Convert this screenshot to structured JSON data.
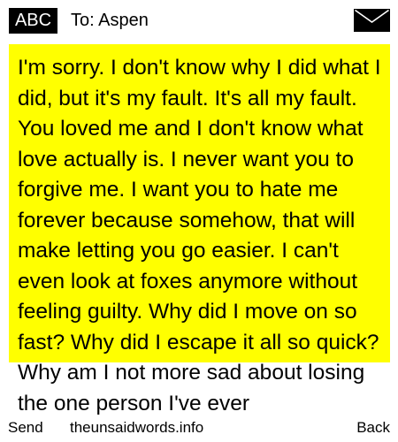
{
  "header": {
    "mode": "ABC",
    "recipient": "To: Aspen",
    "envelope_icon": "envelope-icon"
  },
  "message": {
    "text": "I'm sorry. I don't know why I did what I did, but it's my fault. It's all my fault. You loved me and I don't know what love actually is. I never want you to forgive me. I want you to hate me forever because somehow, that will make letting you go easier. I can't even look at foxes anymore without feeling guilty. Why did I move on so fast? Why did I escape it all so quick? Why am I not more sad about losing the one person I've ever"
  },
  "footer": {
    "send": "Send",
    "site": "theunsaidwords.info",
    "back": "Back"
  },
  "colors": {
    "highlight": "#ffff00",
    "badge_bg": "#000000",
    "badge_text": "#ffffff"
  }
}
